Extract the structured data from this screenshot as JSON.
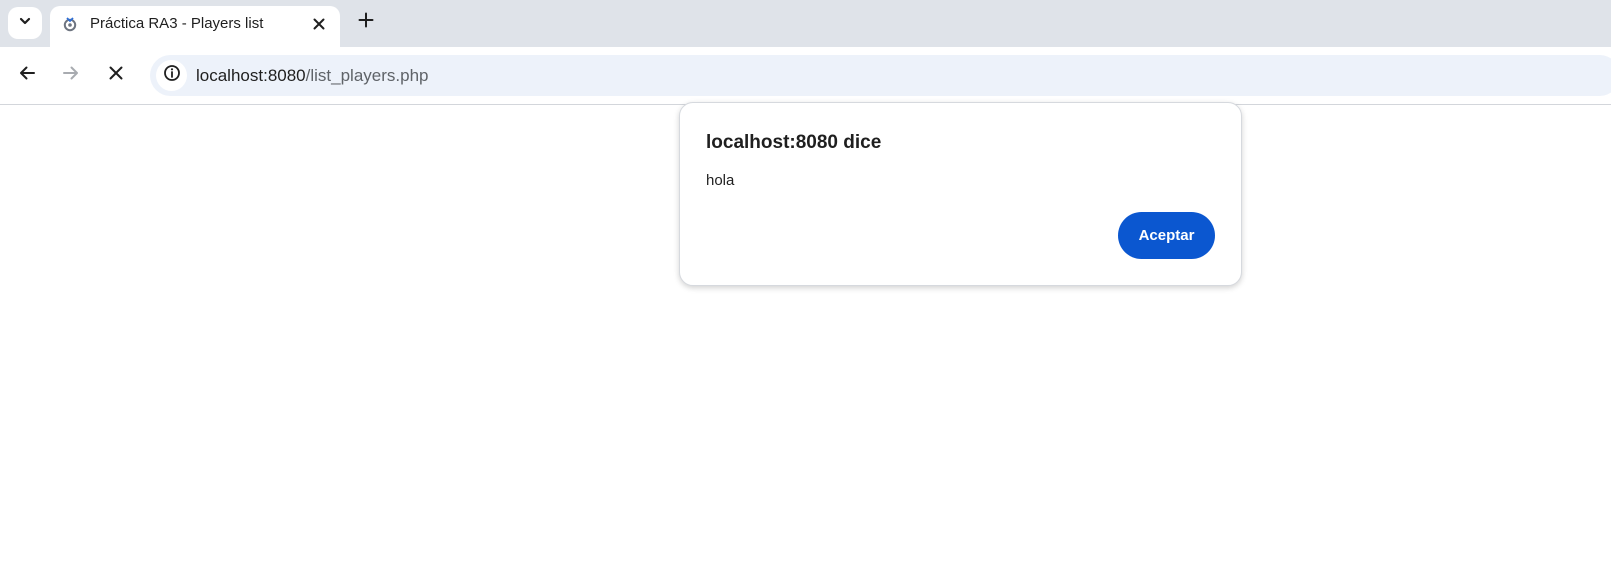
{
  "browser": {
    "tab": {
      "title": "Práctica RA3 - Players list"
    },
    "omnibox": {
      "host": "localhost:8080",
      "path": "/list_players.php"
    }
  },
  "dialog": {
    "title": "localhost:8080 dice",
    "message": "hola",
    "ok_label": "Aceptar"
  },
  "icons": {
    "tab_search": "chevron-down-icon",
    "favicon": "favicon-icon",
    "tab_close": "close-icon",
    "new_tab": "plus-icon",
    "back": "arrow-left-icon",
    "forward": "arrow-right-icon",
    "stop": "stop-icon",
    "site_info": "info-icon"
  },
  "colors": {
    "accent": "#0b57d0",
    "tabstrip": "#dfe3e9",
    "omnibox": "#edf2fa"
  }
}
